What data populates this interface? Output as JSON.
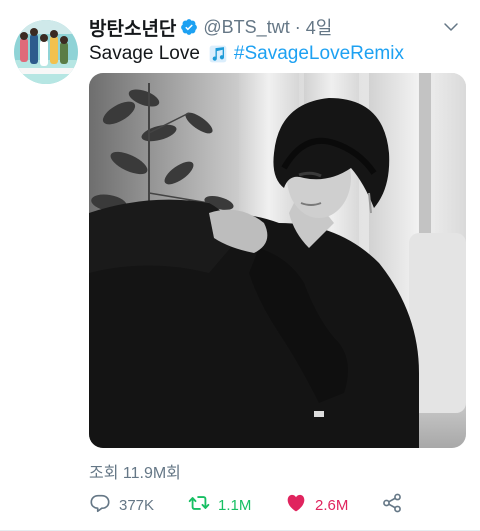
{
  "tweet": {
    "display_name": "방탄소년단",
    "handle": "@BTS_twt",
    "separator": "·",
    "time": "4일",
    "text_prefix": "Savage Love",
    "music_icon": "musical-notes-icon",
    "hashtag": "#SavageLoveRemix",
    "views_label": "조회 11.9M회"
  },
  "actions": {
    "reply_count": "377K",
    "retweet_count": "1.1M",
    "like_count": "2.6M"
  },
  "colors": {
    "link": "#1da1f2",
    "retweet": "#17bf63",
    "like": "#e0245e",
    "muted": "#657786",
    "verified": "#1da1f2"
  }
}
